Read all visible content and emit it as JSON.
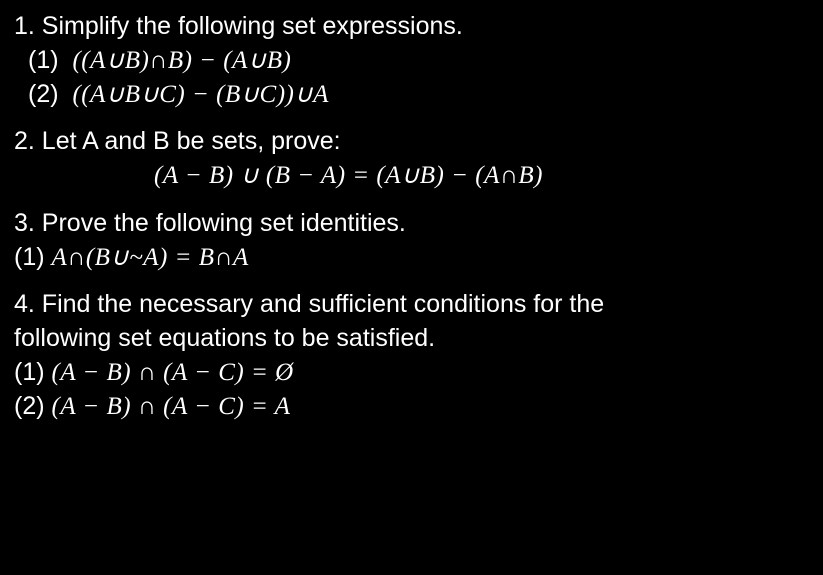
{
  "q1": {
    "stem": "1. Simplify the following set expressions.",
    "p1_label": "(1)",
    "p1_expr": "((A∪B)∩B) −  (A∪B)",
    "p2_label": "(2)",
    "p2_expr": "((A∪B∪C) − (B∪C))∪A"
  },
  "q2": {
    "stem": "2. Let A and B be sets, prove:",
    "expr": "(A  −  B) ∪ (B  −  A) =  (A∪B) −  (A∩B)"
  },
  "q3": {
    "stem": "3. Prove the following set identities.",
    "p1_label": "(1)",
    "p1_expr": "A∩(B∪~A) =  B∩A"
  },
  "q4": {
    "stem_l1": "4. Find the necessary and sufficient conditions for the",
    "stem_l2": "following set equations to be satisfied.",
    "p1_label": "(1)",
    "p1_expr": "(A  −  B) ∩ (A  −  C) =  Ø",
    "p2_label": "(2)",
    "p2_expr": "(A  −  B) ∩ (A  −  C) =  A"
  }
}
